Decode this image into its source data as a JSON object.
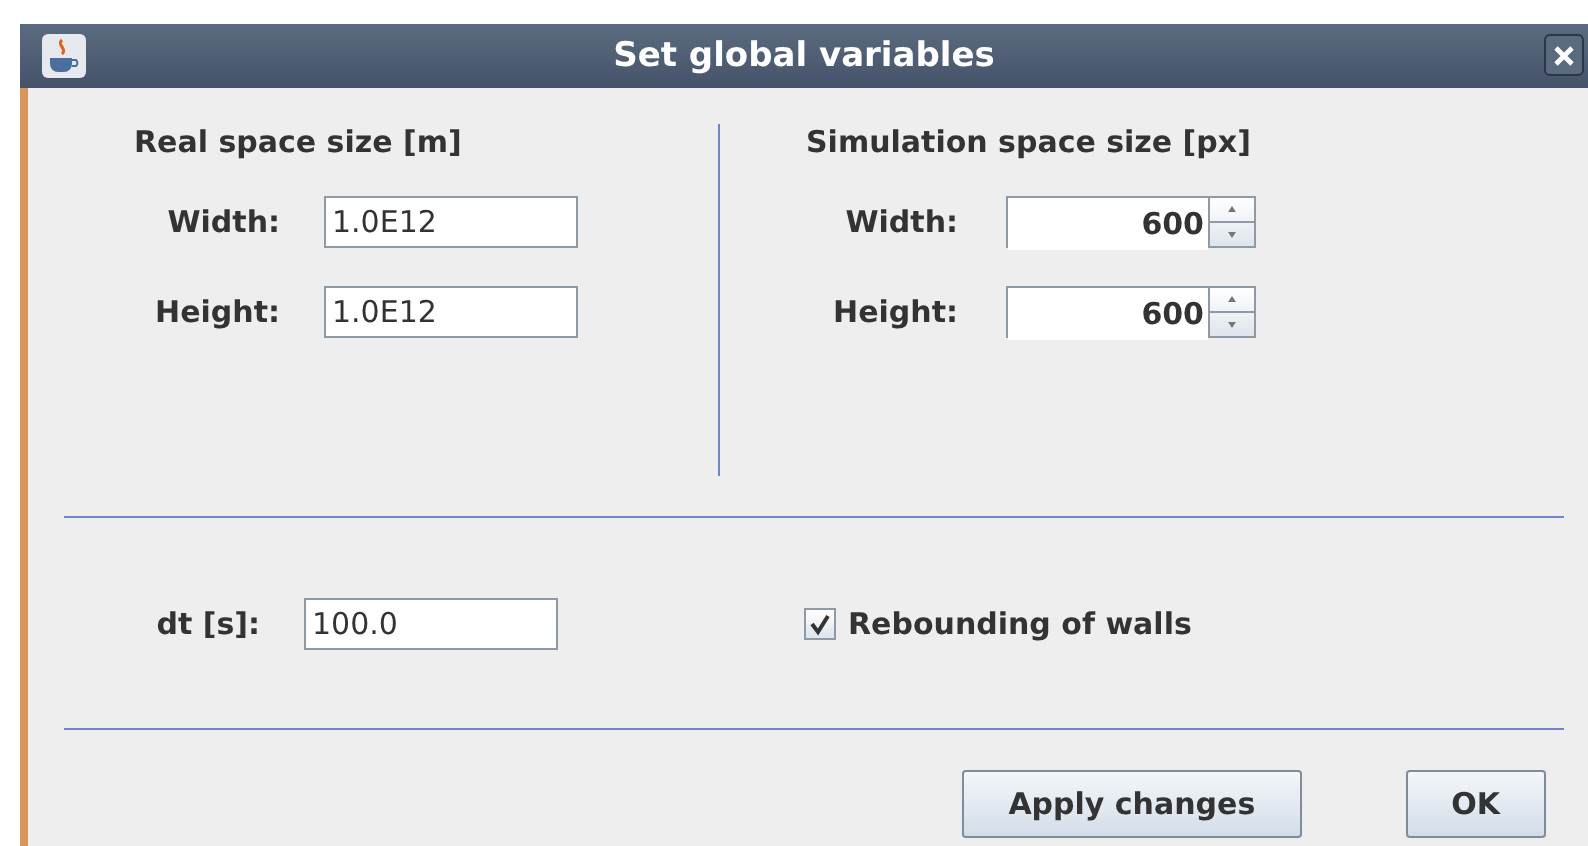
{
  "window": {
    "title": "Set global variables"
  },
  "real_space": {
    "heading": "Real space size [m]",
    "fields": [
      {
        "label": "Width:",
        "value": "1.0E12"
      },
      {
        "label": "Height:",
        "value": "1.0E12"
      }
    ]
  },
  "simulation_space": {
    "heading": "Simulation space size [px]",
    "fields": [
      {
        "label": "Width:",
        "value": "600"
      },
      {
        "label": "Height:",
        "value": "600"
      }
    ]
  },
  "dt": {
    "label": "dt [s]:",
    "value": "100.0"
  },
  "rebounding": {
    "label": "Rebounding of walls",
    "checked": true
  },
  "buttons": [
    "Apply changes",
    "OK"
  ]
}
